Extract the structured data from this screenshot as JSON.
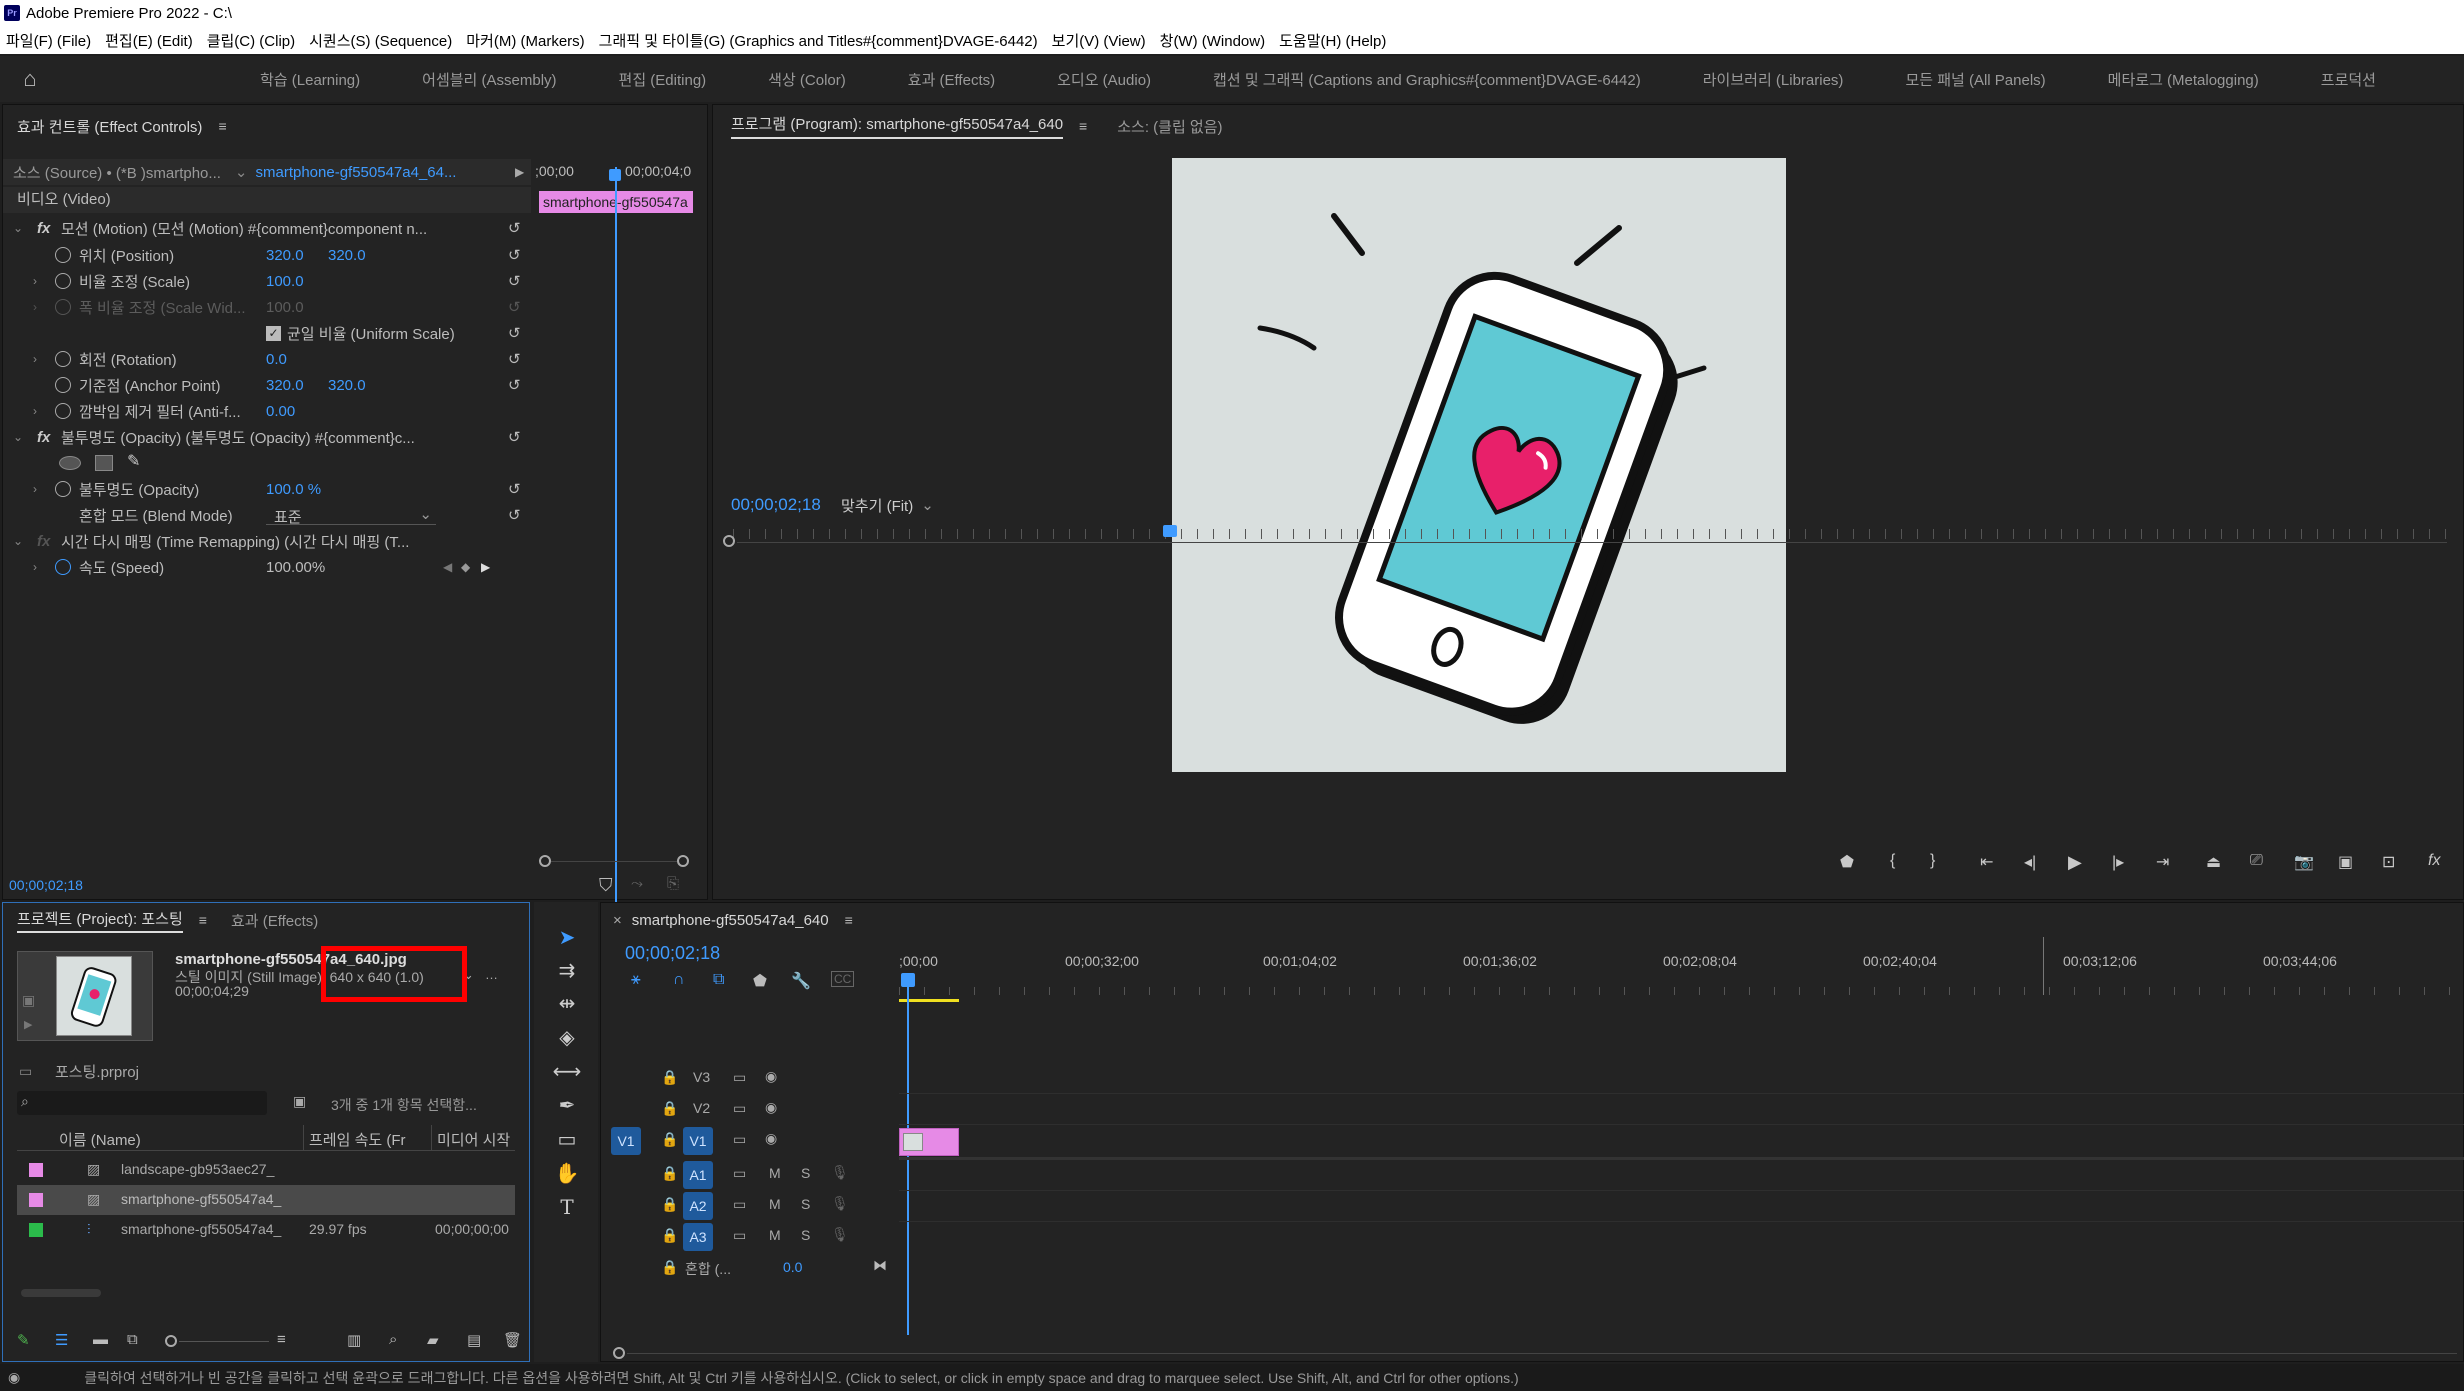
{
  "app": {
    "title": "Adobe Premiere Pro 2022 - C:\\",
    "menu": [
      "파일(F) (File)",
      "편집(E) (Edit)",
      "클립(C) (Clip)",
      "시퀀스(S) (Sequence)",
      "마커(M) (Markers)",
      "그래픽 및 타이틀(G) (Graphics and Titles#{comment}DVAGE-6442)",
      "보기(V) (View)",
      "창(W) (Window)",
      "도움말(H) (Help)"
    ]
  },
  "workspaces": [
    "학습 (Learning)",
    "어셈블리 (Assembly)",
    "편집 (Editing)",
    "색상 (Color)",
    "효과 (Effects)",
    "오디오 (Audio)",
    "캡션 및 그래픽 (Captions and Graphics#{comment}DVAGE-6442)",
    "라이브러리 (Libraries)",
    "모든 패널 (All Panels)",
    "메타로그 (Metalogging)",
    "프로덕션"
  ],
  "effect_controls": {
    "tab": "효과 컨트롤 (Effect Controls)",
    "source_label": "소스 (Source) • (*B )smartpho...",
    "clip_label": "smartphone-gf550547a4_64...",
    "time_a": ";00;00",
    "time_b": "00;00;04;0",
    "clip_bar": "smartphone-gf550547a",
    "section_video": "비디오 (Video)",
    "rows": {
      "motion": "모션 (Motion)   (모션 (Motion) #{comment}component n...",
      "position": "위치 (Position)",
      "pos_x": "320.0",
      "pos_y": "320.0",
      "scale": "비율 조정 (Scale)",
      "scale_val": "100.0",
      "scale_width": "폭 비율 조정 (Scale Wid...",
      "scale_width_val": "100.0",
      "uniform": "균일 비율 (Uniform Scale)",
      "rotation": "회전 (Rotation)",
      "rotation_val": "0.0",
      "anchor": "기준점 (Anchor Point)",
      "anchor_x": "320.0",
      "anchor_y": "320.0",
      "antiflicker": "깜박임 제거 필터 (Anti-f...",
      "antiflicker_val": "0.00",
      "opacity_group": "불투명도 (Opacity)   (불투명도 (Opacity) #{comment}c...",
      "opacity": "불투명도 (Opacity)",
      "opacity_val": "100.0 %",
      "blend": "혼합 모드 (Blend Mode)",
      "blend_val": "표준",
      "timeremap": "시간 다시 매핑 (Time Remapping)   (시간 다시 매핑 (T...",
      "speed": "속도 (Speed)",
      "speed_val": "100.00%"
    },
    "timecode": "00;00;02;18"
  },
  "program": {
    "tab": "프로그램 (Program): smartphone-gf550547a4_640",
    "source_tab": "소스: (클립 없음)",
    "timecode": "00;00;02;18",
    "fit": "맞추기 (Fit)"
  },
  "project": {
    "tab": "프로젝트 (Project): 포스팅",
    "effects_tab": "효과 (Effects)",
    "clip_name": "smartphone-gf550547a4_640.jpg",
    "clip_type": "스틸 이미지 (Still Image), 640 x 640 (1.0)",
    "clip_duration": "00;00;04;29",
    "project_file": "포스팅.prproj",
    "selection_info": "3개 중 1개 항목 선택함...",
    "col_name": "이름 (Name)",
    "col_fps": "프레임 속도 (Fr",
    "col_media": "미디어 시작",
    "items": [
      {
        "name": "landscape-gb953aec27_",
        "fps": "",
        "start": "",
        "color": "#e68ae6"
      },
      {
        "name": "smartphone-gf550547a4_",
        "fps": "",
        "start": "",
        "color": "#e68ae6"
      },
      {
        "name": "smartphone-gf550547a4_",
        "fps": "29.97 fps",
        "start": "00;00;00;00",
        "color": "#2bbb4b"
      }
    ]
  },
  "timeline": {
    "tab": "smartphone-gf550547a4_640",
    "timecode": "00;00;02;18",
    "ruler": [
      ";00;00",
      "00;00;32;00",
      "00;01;04;02",
      "00;01;36;02",
      "00;02;08;04",
      "00;02;40;04",
      "00;03;12;06",
      "00;03;44;06"
    ],
    "video_tracks": [
      "V3",
      "V2",
      "V1"
    ],
    "audio_tracks": [
      "A1",
      "A2",
      "A3"
    ],
    "source_patch": "V1",
    "mix_label": "혼합 (...",
    "mix_val": "0.0"
  },
  "status": "클릭하여 선택하거나 빈 공간을 클릭하고 선택 윤곽으로 드래그합니다. 다른 옵션을 사용하려면 Shift, Alt 및 Ctrl 키를 사용하십시오. (Click to select, or click in empty space and drag to marquee select. Use Shift, Alt, and Ctrl for other options.)",
  "colors": {
    "accent": "#3f9bff",
    "clip_pink": "#e68ae6",
    "highlight_box": "#ff0000"
  }
}
